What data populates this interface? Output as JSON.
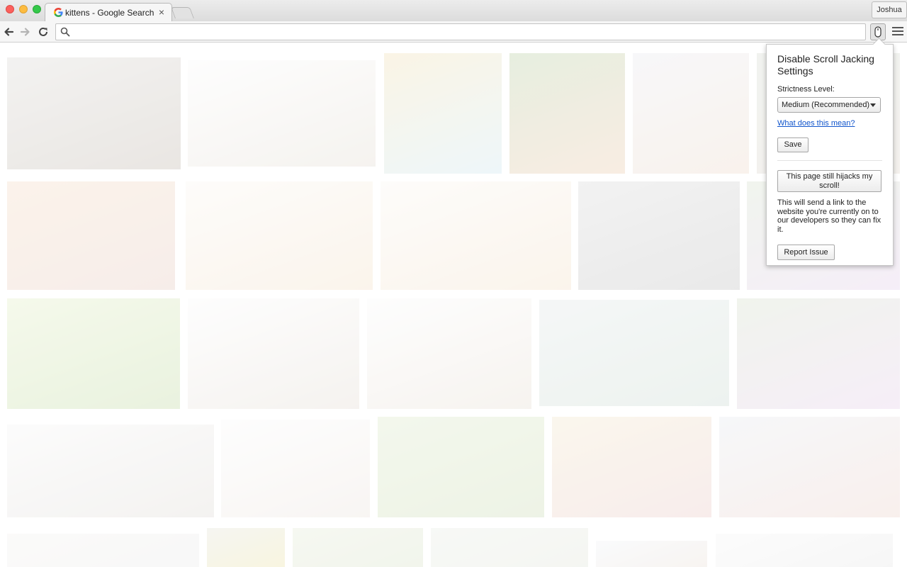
{
  "browser": {
    "tab_title": "kittens - Google Search",
    "tab_close": "×",
    "profile_name": "Joshua",
    "omnibox_value": "",
    "omnibox_placeholder": ""
  },
  "page": {
    "tiles": [
      {
        "c1": "#e4e2df",
        "c2": "#cfc8c0"
      },
      {
        "c1": "#fbfbfb",
        "c2": "#e9e4dc"
      },
      {
        "c1": "#f4e7c6",
        "c2": "#d9ecf3"
      },
      {
        "c1": "#c9d9b9",
        "c2": "#f0d7bf"
      },
      {
        "c1": "#eeeef2",
        "c2": "#f1e2d6"
      },
      {
        "c1": "#dfe3dc",
        "c2": "#e6e0d8"
      },
      {
        "c1": "#f6e4d2",
        "c2": "#ecd7cf"
      },
      {
        "c1": "#fbf8f4",
        "c2": "#f5e7d4"
      },
      {
        "c1": "#fbf8f4",
        "c2": "#f5e7d4"
      },
      {
        "c1": "#e2e2e2",
        "c2": "#cfcfcf"
      },
      {
        "c1": "#dfe7d9",
        "c2": "#e9d9ef"
      },
      {
        "c1": "#e9f2d3",
        "c2": "#cfe2b8"
      },
      {
        "c1": "#fbfbfb",
        "c2": "#e9e3dc"
      },
      {
        "c1": "#fbfbfb",
        "c2": "#ece5dc"
      },
      {
        "c1": "#e8ecec",
        "c2": "#d7e3dc"
      },
      {
        "c1": "#dfe6d7",
        "c2": "#ead9ee"
      },
      {
        "c1": "#f7f7f7",
        "c2": "#e6e3df"
      },
      {
        "c1": "#fbfbfb",
        "c2": "#efe9e4"
      },
      {
        "c1": "#e5eed6",
        "c2": "#d8e4c7"
      },
      {
        "c1": "#f4ecd8",
        "c2": "#efd6d3"
      },
      {
        "c1": "#eceef2",
        "c2": "#f0dcd6"
      },
      {
        "c1": "#f5f4f2",
        "c2": "#eeeeee"
      },
      {
        "c1": "#e9e9e0",
        "c2": "#f0e8b8"
      },
      {
        "c1": "#eaf0e0",
        "c2": "#e1e8d5"
      },
      {
        "c1": "#eef1ea",
        "c2": "#e7ebe2"
      },
      {
        "c1": "#f3f5f8",
        "c2": "#eee6df"
      },
      {
        "c1": "#f7f7f7",
        "c2": "#ececec"
      }
    ]
  },
  "popup": {
    "title": "Disable Scroll Jacking Settings",
    "strictness_label": "Strictness Level:",
    "strictness_selected": "Medium (Recommended)",
    "help_link": "What does this mean?",
    "save_label": "Save",
    "hijack_label": "This page still hijacks my scroll!",
    "description": "This will send a link to the website you're currently on to our developers so they can fix it.",
    "report_label": "Report Issue"
  },
  "colors": {
    "link": "#1155cc",
    "close": "#fc605c",
    "minimize": "#fdbc40",
    "maximize": "#34c84a"
  }
}
